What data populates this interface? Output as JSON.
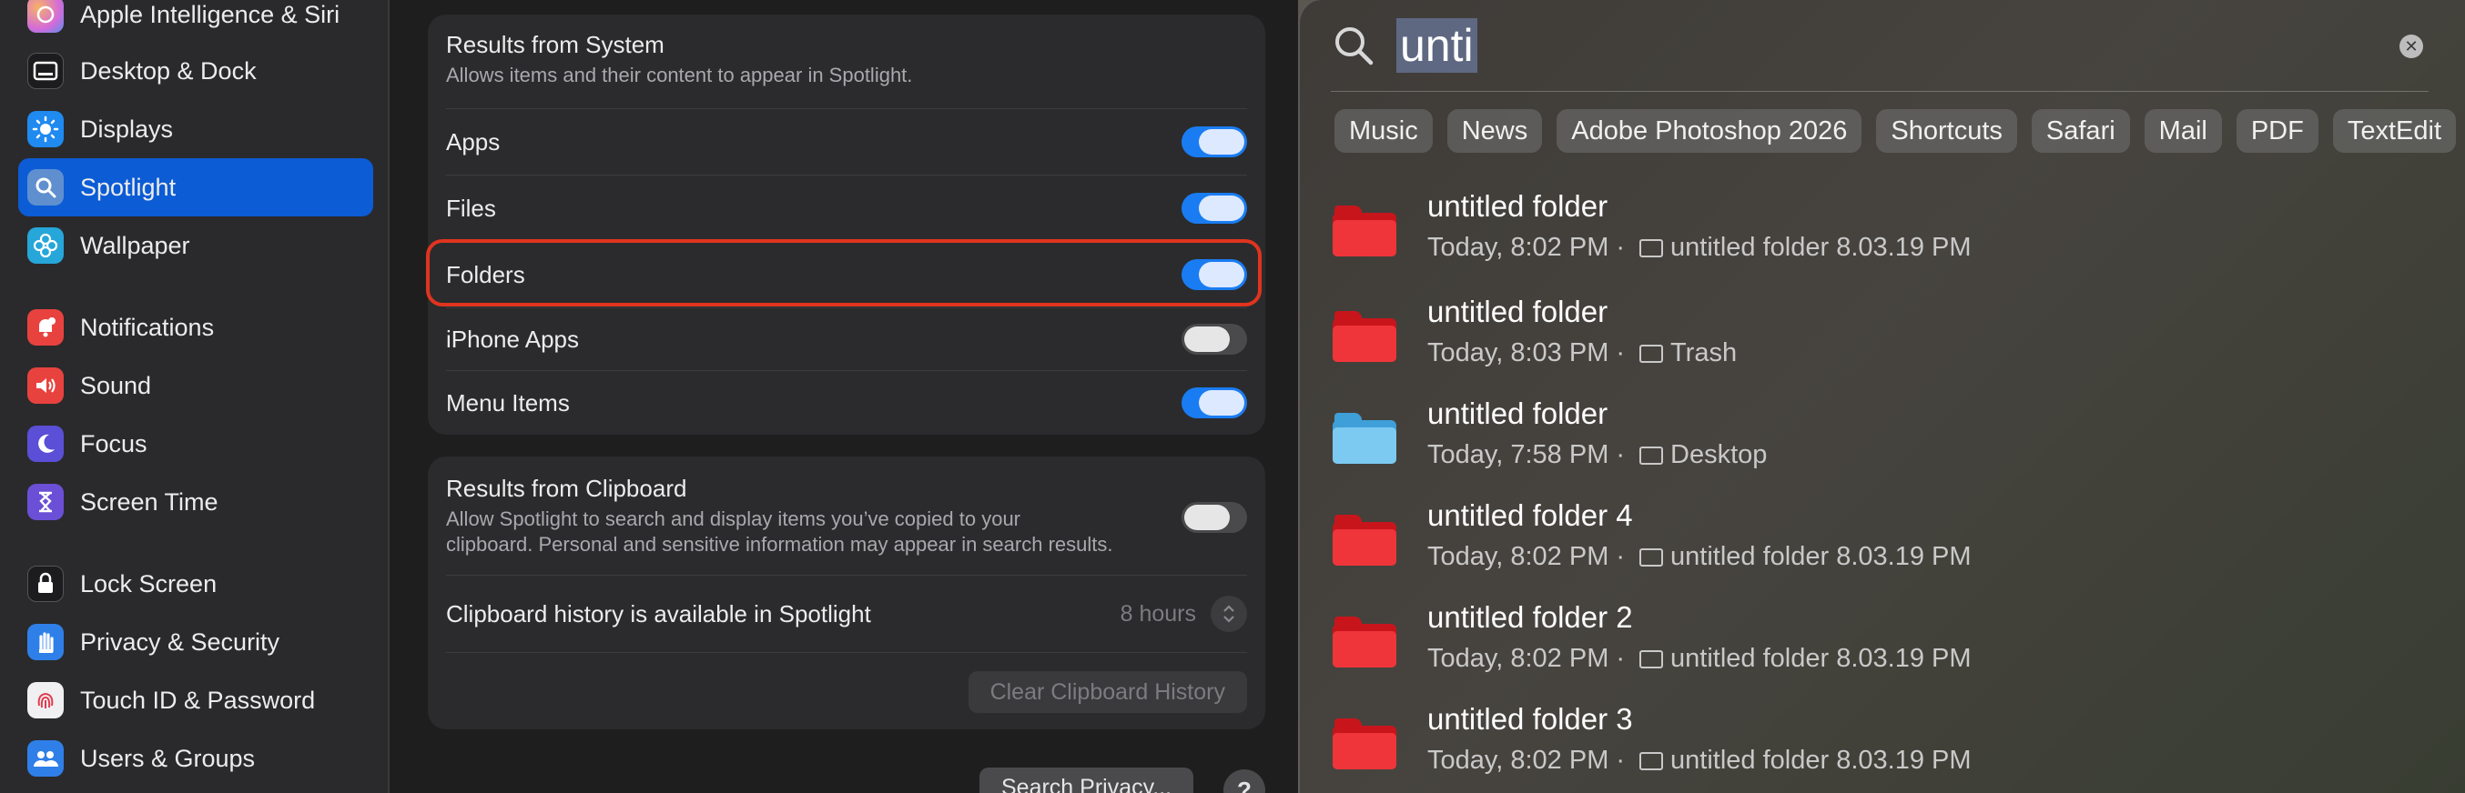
{
  "sidebar": {
    "items": [
      {
        "label": "Apple Intelligence & Siri",
        "icon": "siri-icon",
        "color": "#c58bd6"
      },
      {
        "label": "Desktop & Dock",
        "icon": "dock-icon",
        "color": "#1c1c1e"
      },
      {
        "label": "Displays",
        "icon": "sun-icon",
        "color": "#1f8af0"
      },
      {
        "label": "Spotlight",
        "icon": "magnifier-icon",
        "color": "#5f8fcf",
        "selected": true
      },
      {
        "label": "Wallpaper",
        "icon": "flower-icon",
        "color": "#26a6d9"
      },
      {
        "label": "Notifications",
        "icon": "bell-icon",
        "color": "#e8423f"
      },
      {
        "label": "Sound",
        "icon": "speaker-icon",
        "color": "#e8423f"
      },
      {
        "label": "Focus",
        "icon": "moon-icon",
        "color": "#5a4fd6"
      },
      {
        "label": "Screen Time",
        "icon": "hourglass-icon",
        "color": "#6b4fd6"
      },
      {
        "label": "Lock Screen",
        "icon": "lock-icon",
        "color": "#1c1c1e"
      },
      {
        "label": "Privacy & Security",
        "icon": "hand-icon",
        "color": "#2f7fe8"
      },
      {
        "label": "Touch ID & Password",
        "icon": "fingerprint-icon",
        "color": "#e8e8ea"
      },
      {
        "label": "Users & Groups",
        "icon": "users-icon",
        "color": "#2f7fe8"
      }
    ]
  },
  "system_group": {
    "title": "Results from System",
    "description": "Allows items and their content to appear in Spotlight.",
    "rows": [
      {
        "label": "Apps",
        "on": true
      },
      {
        "label": "Files",
        "on": true
      },
      {
        "label": "Folders",
        "on": true
      },
      {
        "label": "iPhone Apps",
        "on": false
      },
      {
        "label": "Menu Items",
        "on": true
      }
    ]
  },
  "clipboard_group": {
    "title": "Results from Clipboard",
    "description_line1": "Allow Spotlight to search and display items you’ve copied to your",
    "description_line2": "clipboard. Personal and sensitive information may appear in search results.",
    "toggle_on": false,
    "history_label": "Clipboard history is available in Spotlight",
    "history_value": "8 hours",
    "clear_button": "Clear Clipboard History"
  },
  "footer": {
    "privacy_button": "Search Privacy...",
    "help_button": "?"
  },
  "spotlight": {
    "query": "unti",
    "chips": [
      "Music",
      "News",
      "Adobe Photoshop 2026",
      "Shortcuts",
      "Safari",
      "Mail",
      "PDF",
      "TextEdit"
    ],
    "results": [
      {
        "title": "untitled folder",
        "time": "Today, 8:02 PM",
        "location": "untitled folder 8.03.19 PM",
        "folder_color": "red"
      },
      {
        "title": "untitled folder",
        "time": "Today, 8:03 PM",
        "location": "Trash",
        "folder_color": "red"
      },
      {
        "title": "untitled folder",
        "time": "Today, 7:58 PM",
        "location": "Desktop",
        "folder_color": "blue"
      },
      {
        "title": "untitled folder 4",
        "time": "Today, 8:02 PM",
        "location": "untitled folder 8.03.19 PM",
        "folder_color": "red"
      },
      {
        "title": "untitled folder 2",
        "time": "Today, 8:02 PM",
        "location": "untitled folder 8.03.19 PM",
        "folder_color": "red"
      },
      {
        "title": "untitled folder 3",
        "time": "Today, 8:02 PM",
        "location": "untitled folder 8.03.19 PM",
        "folder_color": "red"
      }
    ],
    "separator": "·"
  }
}
